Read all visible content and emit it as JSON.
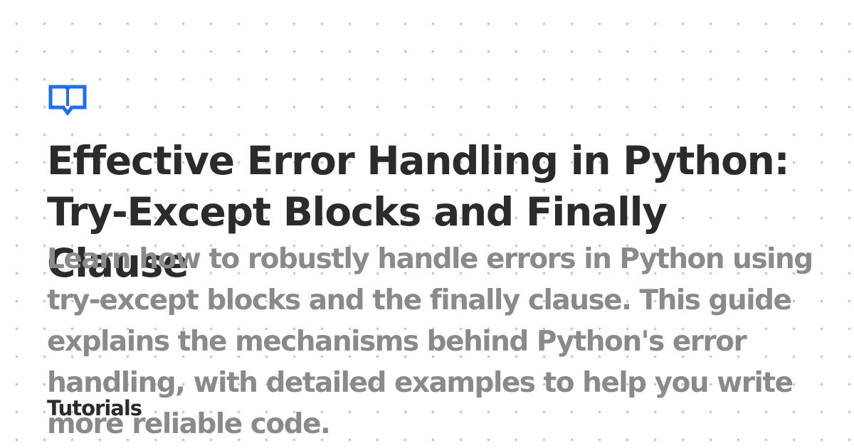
{
  "logo": {
    "icon": "open-book-icon",
    "color": "#1f6feb"
  },
  "title": "Effective Error Handling in Python: Try-Except Blocks and Finally Clause",
  "description": "Learn how to robustly handle errors in Python using try-except blocks and the finally clause. This guide explains the mechanisms behind Python's error handling, with detailed examples to help you write more reliable code.",
  "category": "Tutorials",
  "colors": {
    "background": "#ffffff",
    "dots": "#c9c9c9",
    "title": "#2b2b2b",
    "description": "#8a8a8a",
    "accent": "#1f6feb"
  }
}
